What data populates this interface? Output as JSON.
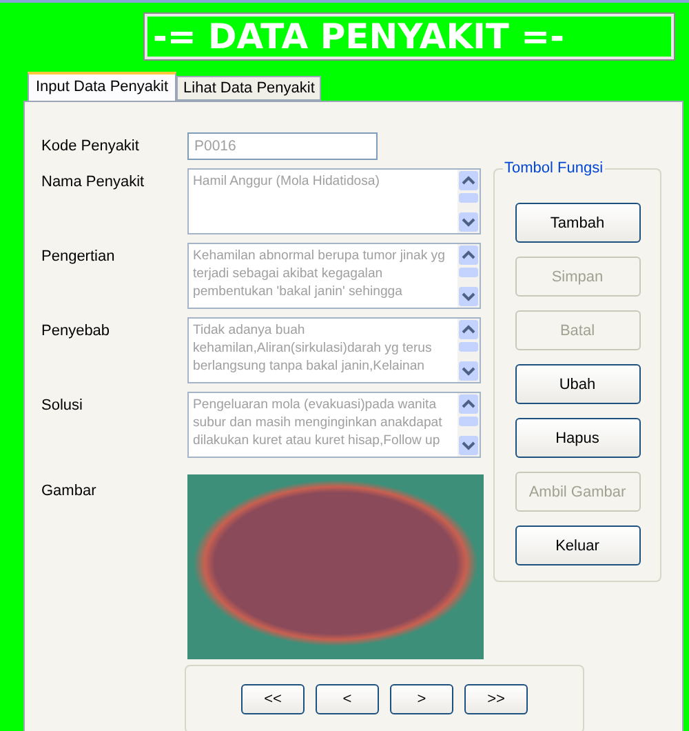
{
  "header": {
    "title": "-= DATA PENYAKIT =-"
  },
  "tabs": [
    {
      "label": "Input Data Penyakit",
      "selected": true
    },
    {
      "label": "Lihat Data Penyakit",
      "selected": false
    }
  ],
  "form": {
    "fields": [
      {
        "label": "Kode Penyakit",
        "kind": "input",
        "disabled": true,
        "lines": [
          "P0016"
        ]
      },
      {
        "label": "Nama Penyakit",
        "kind": "memo",
        "disabled": true,
        "lines": [
          "Hamil Anggur (Mola Hidatidosa)"
        ]
      },
      {
        "label": "Pengertian",
        "kind": "memo",
        "disabled": true,
        "lines": [
          "Kehamilan abnormal berupa tumor jinak yg",
          "terjadi sebagai akibat kegagalan",
          "pembentukan 'bakal janin' sehingga"
        ]
      },
      {
        "label": "Penyebab",
        "kind": "memo",
        "disabled": true,
        "lines": [
          "Tidak adanya buah",
          "kehamilan,Aliran(sirkulasi)darah yg terus",
          "berlangsung tanpa bakal janin,Kelainan"
        ]
      },
      {
        "label": "Solusi",
        "kind": "memo",
        "disabled": true,
        "lines": [
          "Pengeluaran mola (evakuasi)pada wanita",
          "subur dan masih menginginkan anakdapat",
          "dilakukan kuret atau kuret hisap,Follow up"
        ]
      }
    ],
    "image_label": "Gambar"
  },
  "function_group": {
    "title": "Tombol Fungsi",
    "buttons": [
      {
        "label": "Tambah",
        "disabled": false
      },
      {
        "label": "Simpan",
        "disabled": true
      },
      {
        "label": "Batal",
        "disabled": true
      },
      {
        "label": "Ubah",
        "disabled": false
      },
      {
        "label": "Hapus",
        "disabled": false
      },
      {
        "label": "Ambil Gambar",
        "disabled": true
      },
      {
        "label": "Keluar",
        "disabled": false
      }
    ]
  },
  "navigation": [
    "<<",
    "<",
    ">",
    ">>"
  ]
}
